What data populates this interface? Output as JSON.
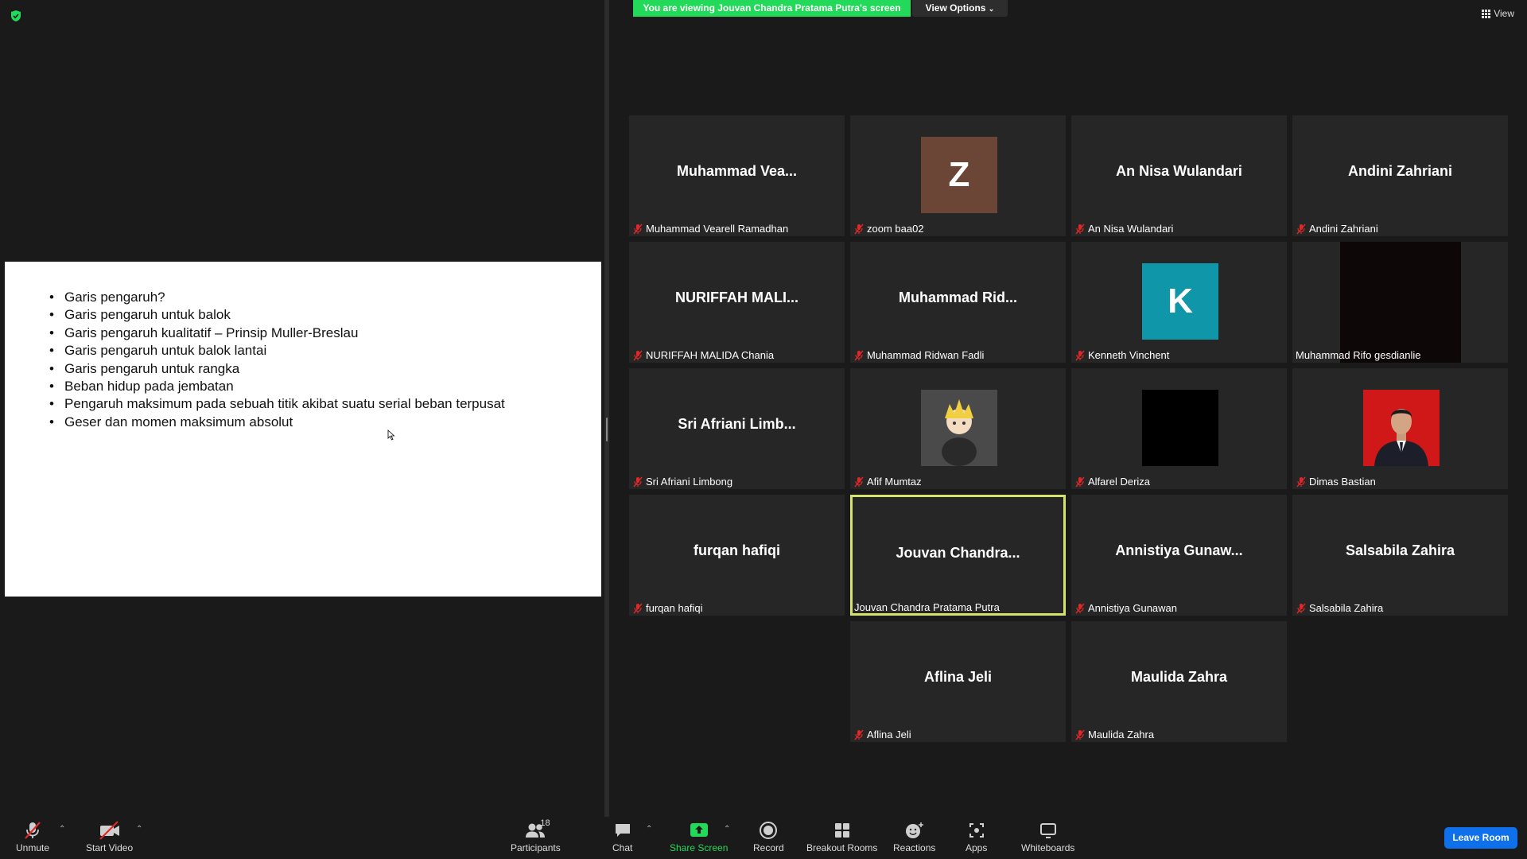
{
  "banner": {
    "viewing_text": "You are viewing Jouvan Chandra Pratama Putra's screen",
    "view_options_label": "View Options",
    "view_label": "View"
  },
  "slide": {
    "bullets": [
      "Garis pengaruh?",
      "Garis pengaruh untuk balok",
      "Garis pengaruh kualitatif – Prinsip Muller-Breslau",
      "Garis pengaruh untuk balok lantai",
      "Garis pengaruh untuk rangka",
      "Beban hidup pada jembatan",
      "Pengaruh maksimum pada sebuah titik akibat suatu serial beban terpusat",
      "Geser dan momen maksimum absolut"
    ]
  },
  "participants": [
    {
      "display": "Muhammad  Vea...",
      "caption": "Muhammad Vearell Ramadhan",
      "muted": true
    },
    {
      "display": "Z",
      "caption": "zoom baa02",
      "muted": true,
      "avatar": "letter",
      "avatar_color": "#6b4535"
    },
    {
      "display": "An Nisa Wulandari",
      "caption": "An Nisa Wulandari",
      "muted": true
    },
    {
      "display": "Andini Zahriani",
      "caption": "Andini Zahriani",
      "muted": true
    },
    {
      "display": "NURIFFAH  MALI...",
      "caption": "NURIFFAH MALIDA Chania",
      "muted": true
    },
    {
      "display": "Muhammad  Rid...",
      "caption": "Muhammad Ridwan Fadli",
      "muted": true
    },
    {
      "display": "K",
      "caption": "Kenneth Vinchent",
      "muted": true,
      "avatar": "letter",
      "avatar_color": "#0f96a8"
    },
    {
      "display": "",
      "caption": "Muhammad Rifo gesdianlie",
      "muted": false,
      "avatar": "video-dark"
    },
    {
      "display": "Sri  Afriani  Limb...",
      "caption": "Sri Afriani Limbong",
      "muted": true
    },
    {
      "display": "",
      "caption": "Afif Mumtaz",
      "muted": true,
      "avatar": "anime-photo"
    },
    {
      "display": "",
      "caption": "Alfarel Deriza",
      "muted": true,
      "avatar": "black-photo"
    },
    {
      "display": "",
      "caption": "Dimas Bastian",
      "muted": true,
      "avatar": "person-photo"
    },
    {
      "display": "furqan hafiqi",
      "caption": "furqan hafiqi",
      "muted": true
    },
    {
      "display": "Jouvan  Chandra...",
      "caption": "Jouvan Chandra Pratama Putra",
      "muted": false,
      "active": true
    },
    {
      "display": "Annistiya  Gunaw...",
      "caption": "Annistiya Gunawan",
      "muted": true
    },
    {
      "display": "Salsabila Zahira",
      "caption": "Salsabila Zahira",
      "muted": true
    },
    {
      "display": "Aflina Jeli",
      "caption": "Aflina Jeli",
      "muted": true
    },
    {
      "display": "Maulida Zahra",
      "caption": "Maulida Zahra",
      "muted": true
    }
  ],
  "toolbar": {
    "unmute": "Unmute",
    "start_video": "Start Video",
    "participants": "Participants",
    "participants_count": "18",
    "chat": "Chat",
    "share_screen": "Share Screen",
    "record": "Record",
    "breakout_rooms": "Breakout Rooms",
    "reactions": "Reactions",
    "apps": "Apps",
    "whiteboards": "Whiteboards",
    "leave_room": "Leave Room"
  },
  "colors": {
    "share_green": "#23d959",
    "active_speaker": "#d6e36a",
    "leave_blue": "#0e71eb",
    "muted_red": "#e02828"
  }
}
